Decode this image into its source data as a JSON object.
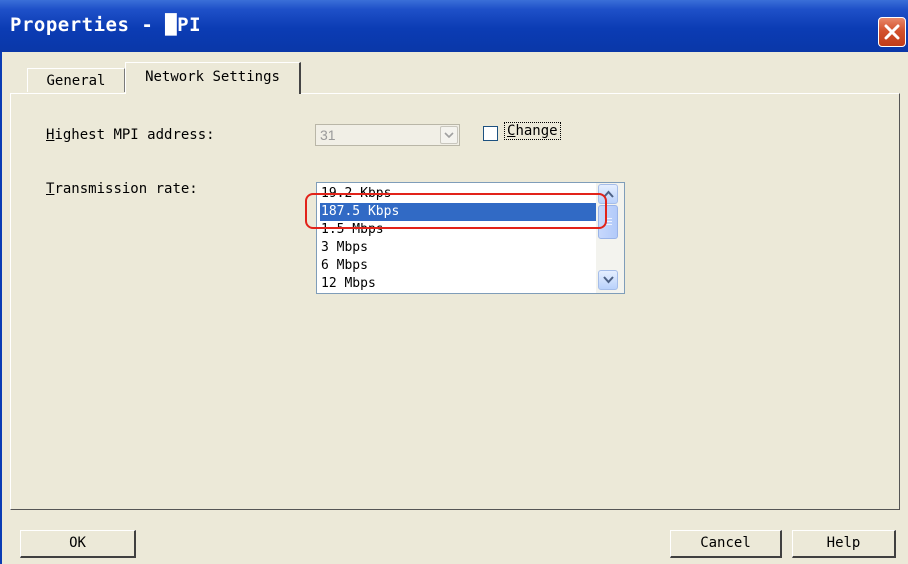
{
  "window": {
    "title": "Properties - █PI",
    "close_icon": "close-icon"
  },
  "tabs": [
    {
      "label": "General",
      "active": false
    },
    {
      "label": "Network Settings",
      "active": true
    }
  ],
  "form": {
    "highest_mpi_address": {
      "label_hotkey": "H",
      "label_rest": "ighest MPI address:",
      "value": "31",
      "enabled": false
    },
    "change_checkbox": {
      "label_hotkey": "C",
      "label_rest": "hange",
      "checked": false
    },
    "transmission_rate": {
      "label_hotkey": "T",
      "label_rest": "ransmission rate:",
      "options": [
        "19.2 Kbps",
        "187.5 Kbps",
        "1.5 Mbps",
        "3 Mbps",
        "6 Mbps",
        "12 Mbps"
      ],
      "selected": "187.5 Kbps"
    }
  },
  "buttons": {
    "ok": "OK",
    "cancel": "Cancel",
    "help": "Help"
  },
  "colors": {
    "titlebar": "#0b3cb4",
    "selection": "#316ac5",
    "annotation": "#e2231a"
  }
}
